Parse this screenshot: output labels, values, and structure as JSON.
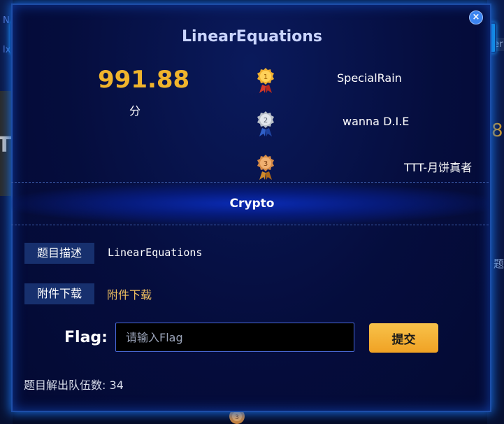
{
  "background": {
    "left_top_text": "N",
    "left_mid_text": "lx",
    "left_card_text": "T",
    "right_tab_text": "Rever",
    "right_score_fragment": "8",
    "right_title_fragment": "题"
  },
  "modal": {
    "title": "LinearEquations",
    "score": "991.88",
    "score_unit": "分",
    "ranking": [
      {
        "rank": "1",
        "name": "SpecialRain",
        "medal": "gold-medal-icon"
      },
      {
        "rank": "2",
        "name": "wanna D.I.E",
        "medal": "silver-medal-icon"
      },
      {
        "rank": "3",
        "name": "TTT-月饼真者",
        "medal": "bronze-medal-icon"
      }
    ],
    "category": "Crypto",
    "description_label": "题目描述",
    "description_value": "LinearEquations",
    "attachment_label": "附件下载",
    "attachment_link": "附件下载",
    "flag_label": "Flag:",
    "flag_placeholder": "请输入Flag",
    "submit_label": "提交",
    "solved_text": "题目解出队伍数: 34"
  },
  "colors": {
    "accent": "#f0b42c",
    "border": "#1d4ea8",
    "tag_bg": "#17306e",
    "button": "#f0a224"
  }
}
